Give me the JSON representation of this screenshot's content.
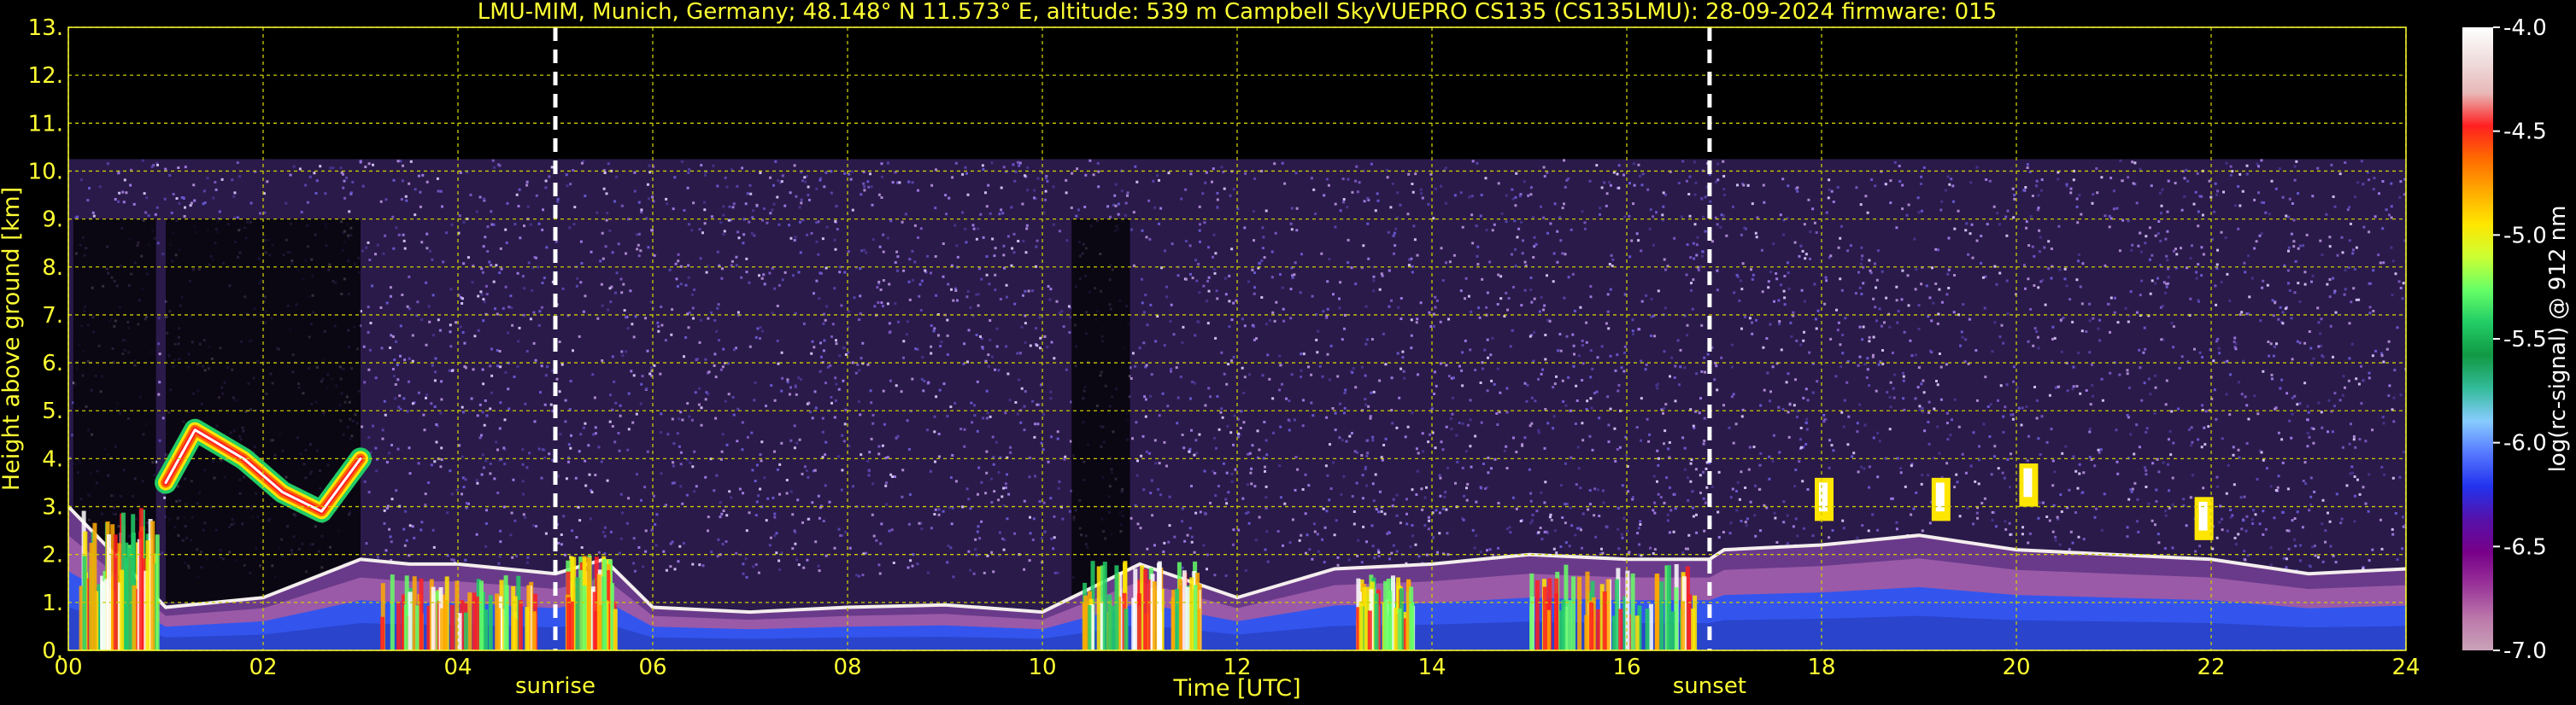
{
  "chart_data": {
    "type": "heatmap",
    "title": "LMU-MIM, Munich, Germany; 48.148° N 11.573° E, altitude: 539 m    Campbell SkyVUEPRO CS135 (CS135LMU): 28-09-2024    firmware: 015",
    "xlabel": "Time [UTC]",
    "ylabel": "Height above ground [km]",
    "xlim": [
      0,
      24
    ],
    "ylim": [
      0,
      13
    ],
    "x_ticks": [
      "00",
      "02",
      "04",
      "06",
      "08",
      "10",
      "12",
      "14",
      "16",
      "18",
      "20",
      "22",
      "24"
    ],
    "y_ticks": [
      "0.",
      "1.",
      "2.",
      "3.",
      "4.",
      "5.",
      "6.",
      "7.",
      "8.",
      "9.",
      "10.",
      "11.",
      "12.",
      "13."
    ],
    "grid": true,
    "events": [
      {
        "label": "sunrise",
        "time": 5.0
      },
      {
        "label": "sunset",
        "time": 16.85
      }
    ],
    "colorbar": {
      "label": "log(rc-signal) @ 912 nm",
      "range": [
        -7.0,
        -4.0
      ],
      "ticks": [
        "-4.0",
        "-4.5",
        "-5.0",
        "-5.5",
        "-6.0",
        "-6.5",
        "-7.0"
      ],
      "colors": [
        "#ffffff",
        "#f0dede",
        "#e8b8b8",
        "#ff2020",
        "#ff6a00",
        "#ffaa00",
        "#ffe600",
        "#ccff33",
        "#66ff66",
        "#22cc66",
        "#119944",
        "#33bb99",
        "#88ccff",
        "#5577ff",
        "#2233ee",
        "#5511aa",
        "#770088",
        "#993399",
        "#bb77aa",
        "#c9a3b8"
      ]
    },
    "layers": [
      {
        "name": "noise",
        "t0": 0.0,
        "t1": 24.0,
        "h0": 0.0,
        "h1": 10.25
      },
      {
        "name": "boundary-layer-top",
        "t": [
          0,
          1,
          2,
          3,
          3.5,
          4,
          5,
          5.5,
          6,
          7,
          8,
          9,
          10,
          11,
          12,
          13,
          14,
          15,
          16,
          16.85,
          17,
          18,
          19,
          20,
          21,
          22,
          23,
          24
        ],
        "h": [
          3.0,
          0.9,
          1.1,
          1.9,
          1.8,
          1.8,
          1.6,
          1.9,
          0.9,
          0.8,
          0.9,
          0.95,
          0.8,
          1.8,
          1.1,
          1.7,
          1.8,
          2.0,
          1.9,
          1.9,
          2.1,
          2.2,
          2.4,
          2.1,
          2.0,
          1.9,
          1.6,
          1.7
        ]
      },
      {
        "name": "elevated-aerosol",
        "t": [
          1.0,
          1.3,
          1.8,
          2.2,
          2.6,
          3.0
        ],
        "h": [
          3.5,
          4.6,
          4.0,
          3.3,
          2.9,
          4.0
        ]
      },
      {
        "name": "residual-clouds",
        "t": [
          18.0,
          19.2,
          20.1,
          21.9
        ],
        "h": [
          3.3,
          3.3,
          3.6,
          2.9
        ]
      }
    ]
  }
}
